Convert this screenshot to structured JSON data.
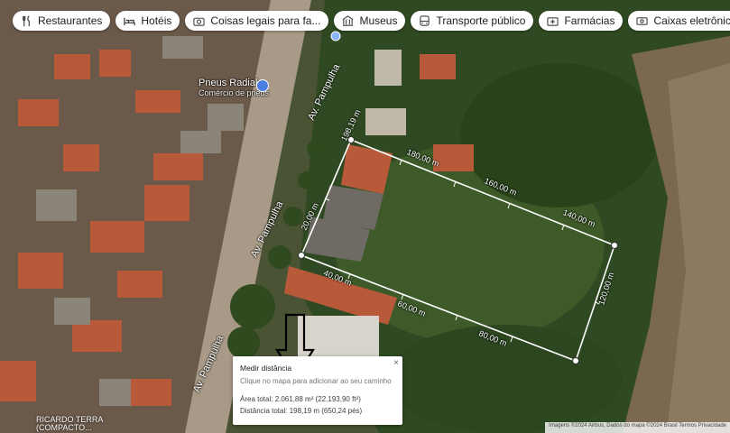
{
  "chips": [
    {
      "label": "Restaurantes",
      "icon": "fork-knife-icon"
    },
    {
      "label": "Hotéis",
      "icon": "bed-icon"
    },
    {
      "label": "Coisas legais para fa...",
      "icon": "camera-icon"
    },
    {
      "label": "Museus",
      "icon": "museum-icon"
    },
    {
      "label": "Transporte público",
      "icon": "bus-icon"
    },
    {
      "label": "Farmácias",
      "icon": "pharmacy-icon"
    },
    {
      "label": "Caixas eletrônicos",
      "icon": "atm-icon"
    }
  ],
  "streets": {
    "top": "Av. Pampulha",
    "mid": "Av. Pampulha",
    "bottom": "Av. Pampulha"
  },
  "poi": {
    "name": "Pneus Radial",
    "category": "Comércio de pneus"
  },
  "place_label": {
    "line1": "RICARDO TERRA",
    "line2": "(COMPACTO..."
  },
  "measurements": {
    "start_label": "198,19 m",
    "left_labels": [
      "20,00 m"
    ],
    "top_labels": [
      "180,00 m",
      "160,00 m",
      "140,00 m"
    ],
    "right_labels": [
      "120,00 m"
    ],
    "bottom_labels": [
      "40,00 m",
      "60,00 m",
      "80,00 m"
    ]
  },
  "panel": {
    "title": "Medir distância",
    "hint": "Clique no mapa para adicionar ao seu caminho",
    "area": "Área total: 2.061,88 m² (22.193,90 ft²)",
    "distance": "Distância total: 198,19 m (650,24 pés)",
    "close": "×"
  },
  "footer": "Imagens ©2024 Airbus, Dados do mapa ©2024   Brasil   Termos   Privacidade"
}
